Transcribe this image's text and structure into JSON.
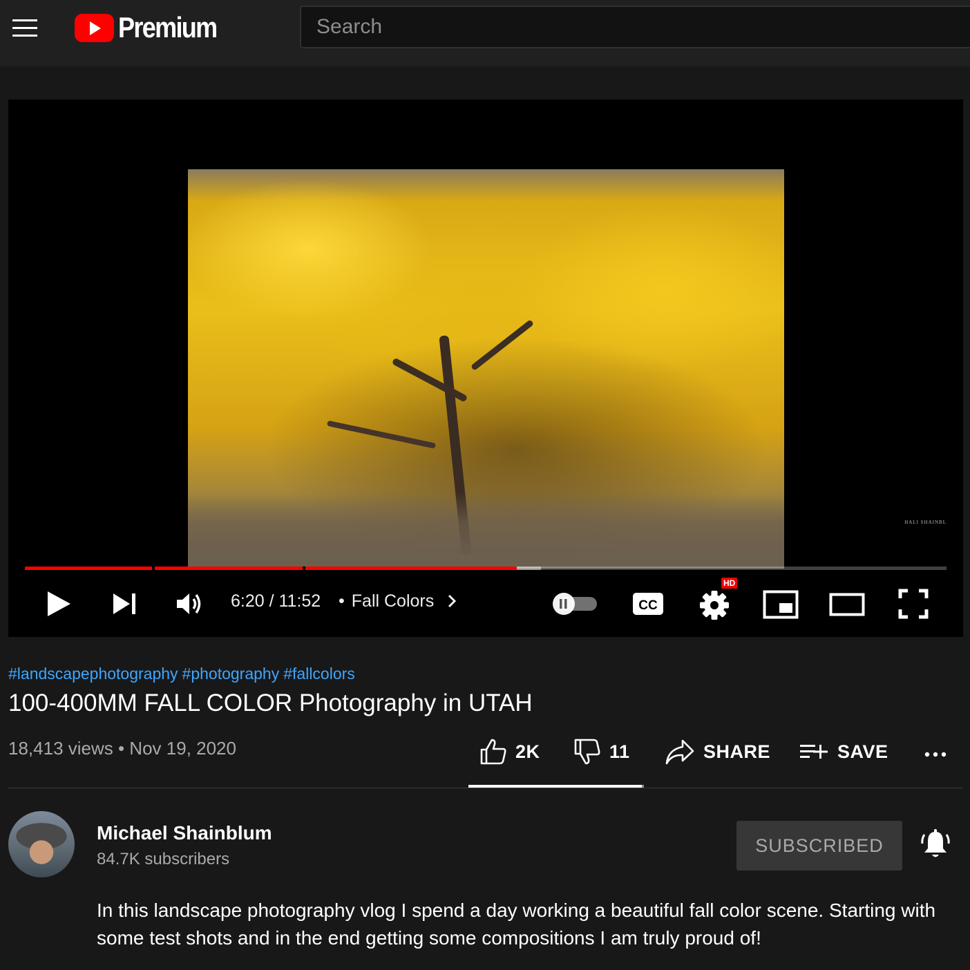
{
  "header": {
    "logo_text": "Premium",
    "search_placeholder": "Search"
  },
  "player": {
    "current_time": "6:20",
    "duration": "11:52",
    "time_display": "6:20 / 11:52",
    "chapter_label": "Fall Colors",
    "played_fraction": 0.534,
    "buffered_fraction": 0.56,
    "hd_badge": "HD",
    "cc_label": "CC",
    "watermark": "HALI  SHAINBL",
    "autoplay": false
  },
  "video": {
    "hashtags": [
      "#landscapephotography",
      "#photography",
      "#fallcolors"
    ],
    "title": "100-400MM FALL COLOR Photography in UTAH",
    "meta": "18,413 views • Nov 19, 2020",
    "likes": "2K",
    "dislikes": "11",
    "share_label": "SHARE",
    "save_label": "SAVE",
    "like_ratio": 0.99
  },
  "channel": {
    "name": "Michael Shainblum",
    "subscribers": "84.7K subscribers",
    "subscribe_label": "SUBSCRIBED"
  },
  "description": "In this landscape photography vlog I spend a day working a beautiful fall color scene. Starting with some test shots and in the end getting some compositions I am truly proud of!",
  "icons": {
    "menu": "hamburger-menu-icon",
    "play": "play-icon",
    "next": "next-icon",
    "volume": "volume-icon",
    "settings": "gear-icon",
    "miniplayer": "miniplayer-icon",
    "theater": "theater-mode-icon",
    "fullscreen": "fullscreen-icon",
    "like": "thumbs-up-icon",
    "dislike": "thumbs-down-icon",
    "share": "share-arrow-icon",
    "save": "playlist-add-icon",
    "more": "more-horizontal-icon",
    "bell": "notification-bell-icon"
  },
  "colors": {
    "accent": "#ff0000",
    "link": "#3ea6ff",
    "background": "#181818"
  }
}
